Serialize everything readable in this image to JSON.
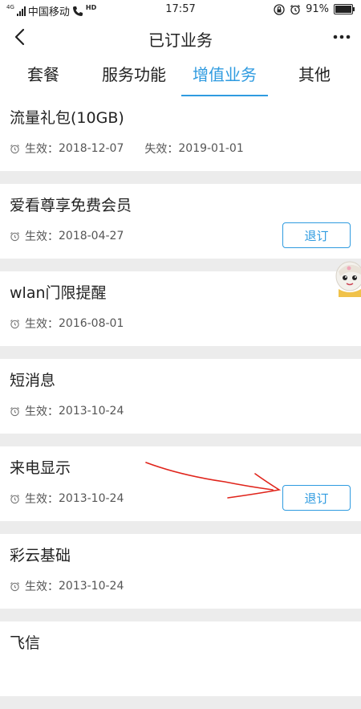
{
  "status_bar": {
    "network": "4G",
    "carrier": "中国移动",
    "hd": "HD",
    "time": "17:57",
    "battery": "91%",
    "battery_level": 0.91
  },
  "header": {
    "title": "已订业务",
    "back_icon": "chevron-left-icon",
    "more_icon": "more-dots-icon"
  },
  "tabs": [
    {
      "label": "套餐",
      "active": false
    },
    {
      "label": "服务功能",
      "active": false
    },
    {
      "label": "增值业务",
      "active": true
    },
    {
      "label": "其他",
      "active": false
    }
  ],
  "accent_color": "#2f9be0",
  "items": [
    {
      "name": "流量礼包(10GB)",
      "effective_label": "生效：",
      "effective": "2018-12-07",
      "expire_label": "失效：",
      "expire": "2019-01-01"
    },
    {
      "name": "爱看尊享免费会员",
      "effective_label": "生效：",
      "effective": "2018-04-27",
      "button": "退订"
    },
    {
      "name": "wlan门限提醒",
      "effective_label": "生效：",
      "effective": "2016-08-01"
    },
    {
      "name": "短消息",
      "effective_label": "生效：",
      "effective": "2013-10-24"
    },
    {
      "name": "来电显示",
      "effective_label": "生效：",
      "effective": "2013-10-24",
      "button": "退订"
    },
    {
      "name": "彩云基础",
      "effective_label": "生效：",
      "effective": "2013-10-24"
    },
    {
      "name": "飞信"
    }
  ]
}
